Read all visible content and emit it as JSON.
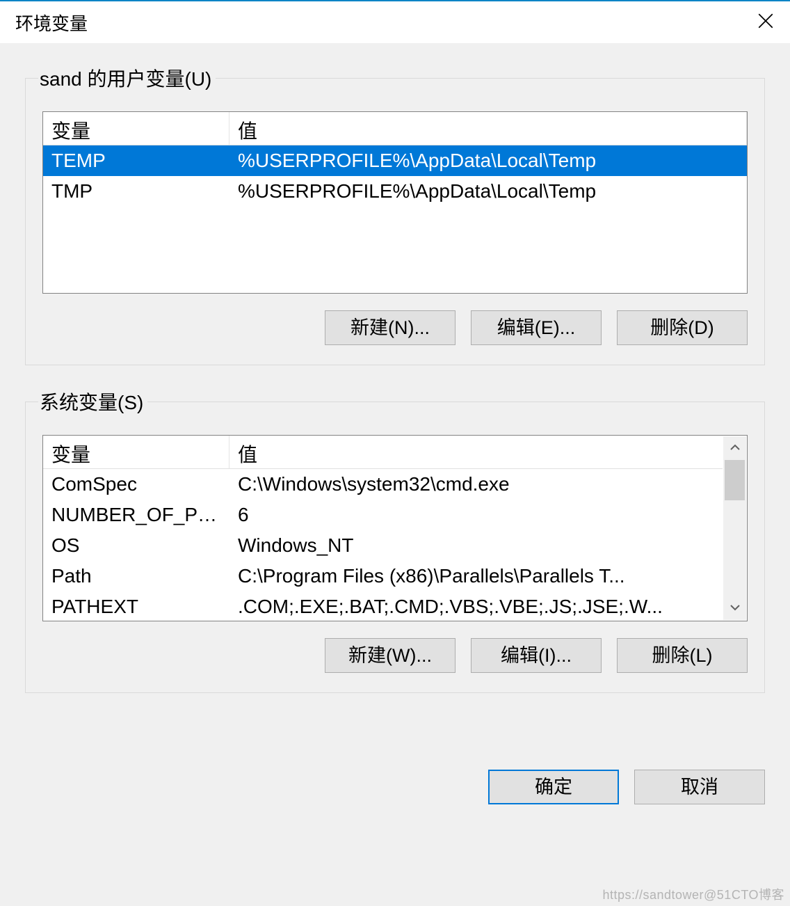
{
  "window": {
    "title": "环境变量"
  },
  "user_vars": {
    "legend": "sand 的用户变量(U)",
    "columns": {
      "variable": "变量",
      "value": "值"
    },
    "rows": [
      {
        "variable": "TEMP",
        "value": "%USERPROFILE%\\AppData\\Local\\Temp",
        "selected": true
      },
      {
        "variable": "TMP",
        "value": "%USERPROFILE%\\AppData\\Local\\Temp",
        "selected": false
      }
    ],
    "buttons": {
      "new": "新建(N)...",
      "edit": "编辑(E)...",
      "delete": "删除(D)"
    }
  },
  "system_vars": {
    "legend": "系统变量(S)",
    "columns": {
      "variable": "变量",
      "value": "值"
    },
    "rows": [
      {
        "variable": "ComSpec",
        "value": "C:\\Windows\\system32\\cmd.exe"
      },
      {
        "variable": "NUMBER_OF_PRO...",
        "value": "6"
      },
      {
        "variable": "OS",
        "value": "Windows_NT"
      },
      {
        "variable": "Path",
        "value": "C:\\Program Files (x86)\\Parallels\\Parallels T..."
      },
      {
        "variable": "PATHEXT",
        "value": ".COM;.EXE;.BAT;.CMD;.VBS;.VBE;.JS;.JSE;.W..."
      }
    ],
    "buttons": {
      "new": "新建(W)...",
      "edit": "编辑(I)...",
      "delete": "删除(L)"
    }
  },
  "dialog_buttons": {
    "ok": "确定",
    "cancel": "取消"
  },
  "watermark": "https://sandtower@51CTO博客"
}
